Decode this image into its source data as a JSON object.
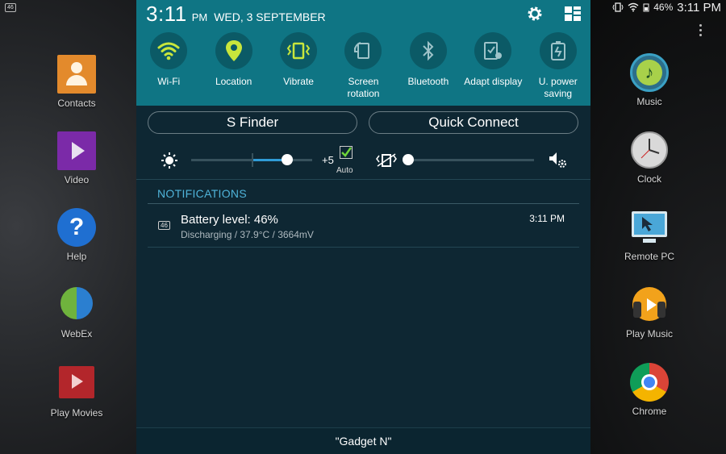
{
  "status_bar": {
    "left_badge": "46",
    "battery": "46%",
    "time": "3:11 PM",
    "icons": [
      "vibrate-icon",
      "wifi-icon",
      "signal-icon"
    ]
  },
  "panel": {
    "clock": "3:11",
    "ampm": "PM",
    "date": "WED, 3 SEPTEMBER",
    "toggles": [
      {
        "label": "Wi-Fi",
        "icon": "wifi-icon",
        "active": true
      },
      {
        "label": "Location",
        "icon": "location-pin-icon",
        "active": true
      },
      {
        "label": "Vibrate",
        "icon": "vibrate-icon",
        "active": true
      },
      {
        "label": "Screen rotation",
        "icon": "screen-rotation-icon",
        "active": false
      },
      {
        "label": "Bluetooth",
        "icon": "bluetooth-icon",
        "active": false
      },
      {
        "label": "Adapt display",
        "icon": "adapt-display-icon",
        "active": false
      },
      {
        "label": "U. power saving",
        "icon": "power-saving-icon",
        "active": false
      }
    ],
    "s_finder": "S Finder",
    "quick_connect": "Quick Connect",
    "brightness": {
      "value_label": "+5",
      "auto_label": "Auto",
      "auto_checked": true,
      "level": 0.79
    },
    "volume": {
      "level": 0.0
    },
    "notifications_header": "NOTIFICATIONS",
    "notification": {
      "badge": "46",
      "title": "Battery level: 46%",
      "subtitle": "Discharging / 37.9°C / 3664mV",
      "time": "3:11 PM"
    },
    "footer": "\"Gadget N\""
  },
  "home_apps": {
    "left": [
      {
        "label": "Contacts",
        "icon": "contacts-icon"
      },
      {
        "label": "Video",
        "icon": "video-icon"
      },
      {
        "label": "Help",
        "icon": "help-icon"
      },
      {
        "label": "WebEx",
        "icon": "webex-icon"
      },
      {
        "label": "Play Movies",
        "icon": "play-movies-icon"
      }
    ],
    "right": [
      {
        "label": "Music",
        "icon": "music-icon"
      },
      {
        "label": "Clock",
        "icon": "clock-icon"
      },
      {
        "label": "Remote PC",
        "icon": "remote-pc-icon"
      },
      {
        "label": "Play Music",
        "icon": "play-music-icon"
      },
      {
        "label": "Chrome",
        "icon": "chrome-icon"
      }
    ]
  },
  "colors": {
    "panel_header": "#0f7584",
    "panel_body": "#0e2733",
    "active_toggle": "#c8e63c",
    "accent": "#2f9bd6",
    "notif_header": "#4fb3d9"
  }
}
